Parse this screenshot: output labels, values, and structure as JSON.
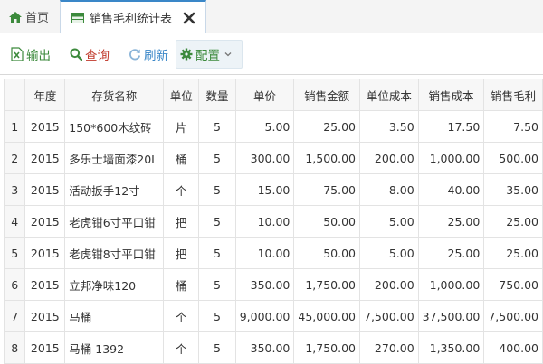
{
  "tabs": {
    "home_label": "首页",
    "active_label": "销售毛利统计表"
  },
  "toolbar": {
    "export_label": "输出",
    "query_label": "查询",
    "refresh_label": "刷新",
    "config_label": "配置"
  },
  "table": {
    "headers": [
      "",
      "年度",
      "存货名称",
      "单位",
      "数量",
      "单价",
      "销售金额",
      "单位成本",
      "销售成本",
      "销售毛利"
    ],
    "rows": [
      [
        "1",
        "2015",
        "150*600木纹砖",
        "片",
        "5",
        "5.00",
        "25.00",
        "3.50",
        "17.50",
        "7.50"
      ],
      [
        "2",
        "2015",
        "多乐士墙面漆20L",
        "桶",
        "5",
        "300.00",
        "1,500.00",
        "200.00",
        "1,000.00",
        "500.00"
      ],
      [
        "3",
        "2015",
        "活动扳手12寸",
        "个",
        "5",
        "15.00",
        "75.00",
        "8.00",
        "40.00",
        "35.00"
      ],
      [
        "4",
        "2015",
        "老虎钳6寸平口钳",
        "把",
        "5",
        "10.00",
        "50.00",
        "5.00",
        "25.00",
        "25.00"
      ],
      [
        "5",
        "2015",
        "老虎钳8寸平口钳",
        "把",
        "5",
        "10.00",
        "50.00",
        "5.00",
        "25.00",
        "25.00"
      ],
      [
        "6",
        "2015",
        "立邦净味120",
        "桶",
        "5",
        "350.00",
        "1,750.00",
        "200.00",
        "1,000.00",
        "750.00"
      ],
      [
        "7",
        "2015",
        "马桶",
        "个",
        "5",
        "9,000.00",
        "45,000.00",
        "7,500.00",
        "37,500.00",
        "7,500.00"
      ],
      [
        "8",
        "2015",
        "马桶 1392",
        "个",
        "5",
        "350.00",
        "1,750.00",
        "270.00",
        "1,350.00",
        "400.00"
      ]
    ]
  }
}
